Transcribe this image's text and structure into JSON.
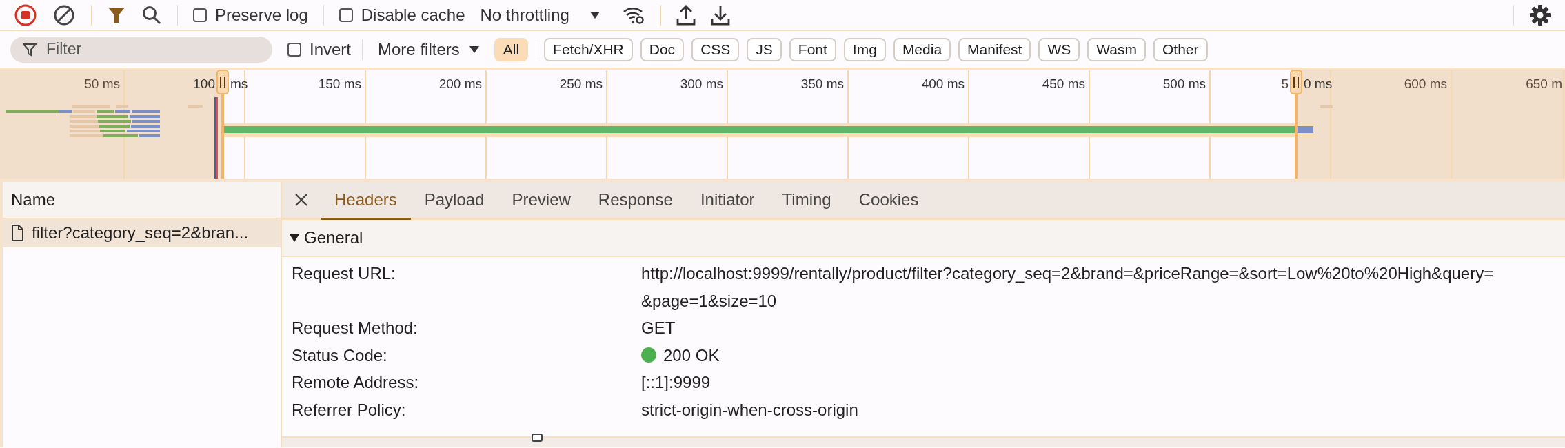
{
  "toolbar": {
    "filter_on": true,
    "preserve_log": {
      "label": "Preserve log",
      "checked": false
    },
    "disable_cache": {
      "label": "Disable cache",
      "checked": false
    },
    "throttling": "No throttling"
  },
  "filter_bar": {
    "placeholder": "Filter",
    "invert": {
      "label": "Invert",
      "checked": false
    },
    "more_filters": "More filters",
    "types": [
      {
        "label": "All",
        "selected": true
      },
      {
        "label": "Fetch/XHR",
        "selected": false
      },
      {
        "label": "Doc",
        "selected": false
      },
      {
        "label": "CSS",
        "selected": false
      },
      {
        "label": "JS",
        "selected": false
      },
      {
        "label": "Font",
        "selected": false
      },
      {
        "label": "Img",
        "selected": false
      },
      {
        "label": "Media",
        "selected": false
      },
      {
        "label": "Manifest",
        "selected": false
      },
      {
        "label": "WS",
        "selected": false
      },
      {
        "label": "Wasm",
        "selected": false
      },
      {
        "label": "Other",
        "selected": false
      }
    ]
  },
  "overview": {
    "ticks": [
      {
        "text": "50 ms"
      },
      {
        "text": "100",
        "after": "ms"
      },
      {
        "text": "150 ms"
      },
      {
        "text": "200 ms"
      },
      {
        "text": "250 ms"
      },
      {
        "text": "300 ms"
      },
      {
        "text": "350 ms"
      },
      {
        "text": "400 ms"
      },
      {
        "text": "450 ms"
      },
      {
        "text": "500 ms"
      },
      {
        "text": "5",
        "after": "0 ms"
      },
      {
        "text": "600 ms"
      },
      {
        "text": "650 m"
      }
    ]
  },
  "requests": {
    "column": "Name",
    "rows": [
      {
        "name": "filter?category_seq=2&bran...",
        "selected": true
      }
    ]
  },
  "details": {
    "tabs": [
      {
        "label": "Headers",
        "selected": true
      },
      {
        "label": "Payload",
        "selected": false
      },
      {
        "label": "Preview",
        "selected": false
      },
      {
        "label": "Response",
        "selected": false
      },
      {
        "label": "Initiator",
        "selected": false
      },
      {
        "label": "Timing",
        "selected": false
      },
      {
        "label": "Cookies",
        "selected": false
      }
    ],
    "section": {
      "title": "General",
      "expanded": true,
      "rows": [
        {
          "kind": "text",
          "label": "Request URL:",
          "value": "http://localhost:9999/rentally/product/filter?category_seq=2&brand=&priceRange=&sort=Low%20to%20High&query=&page=1&size=10"
        },
        {
          "kind": "text",
          "label": "Request Method:",
          "value": "GET"
        },
        {
          "kind": "status",
          "label": "Status Code:",
          "value": "200 OK"
        },
        {
          "kind": "text",
          "label": "Remote Address:",
          "value": "[::1]:9999"
        },
        {
          "kind": "text",
          "label": "Referrer Policy:",
          "value": "strict-origin-when-cross-origin"
        }
      ]
    }
  }
}
